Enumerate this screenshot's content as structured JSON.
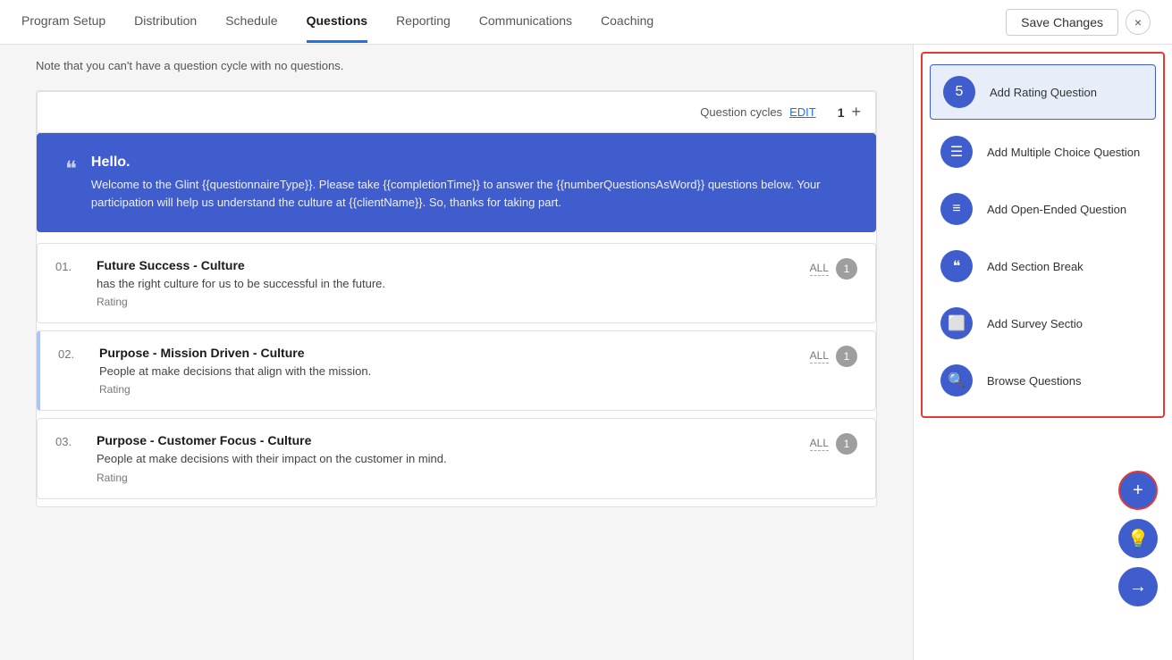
{
  "header": {
    "nav": [
      {
        "id": "program-setup",
        "label": "Program Setup",
        "active": false
      },
      {
        "id": "distribution",
        "label": "Distribution",
        "active": false
      },
      {
        "id": "schedule",
        "label": "Schedule",
        "active": false
      },
      {
        "id": "questions",
        "label": "Questions",
        "active": true
      },
      {
        "id": "reporting",
        "label": "Reporting",
        "active": false
      },
      {
        "id": "communications",
        "label": "Communications",
        "active": false
      },
      {
        "id": "coaching",
        "label": "Coaching",
        "active": false
      }
    ],
    "save_label": "Save Changes",
    "close_label": "×"
  },
  "note": "Note that you can't have a question cycle with no questions.",
  "question_cycles": {
    "label": "Question cycles",
    "edit_label": "EDIT",
    "cycle_number": "1"
  },
  "welcome": {
    "title": "Hello.",
    "body": "Welcome to the Glint {{questionnaireType}}. Please take {{completionTime}} to answer the {{numberQuestionsAsWord}} questions below. Your participation will help us understand the culture at {{clientName}}. So, thanks for taking part."
  },
  "questions": [
    {
      "number": "01.",
      "title": "Future Success - Culture",
      "body": "<COMPANY_NAME> has the right culture for us to be successful in the future.",
      "type": "Rating",
      "audience": "ALL",
      "cycle": "1"
    },
    {
      "number": "02.",
      "title": "Purpose - Mission Driven - Culture",
      "body": "People at <COMPANY_NAME> make decisions that align with the mission.",
      "type": "Rating",
      "audience": "ALL",
      "cycle": "1",
      "highlighted": true
    },
    {
      "number": "03.",
      "title": "Purpose - Customer Focus - Culture",
      "body": "People at <COMPANY_NAME> make decisions with their impact on the customer in mind.",
      "type": "Rating",
      "audience": "ALL",
      "cycle": "1"
    }
  ],
  "panel": {
    "items": [
      {
        "id": "add-rating",
        "icon": "5",
        "label": "Add Rating Question",
        "selected": true
      },
      {
        "id": "add-multiple",
        "icon": "☰",
        "label": "Add Multiple Choice Question",
        "selected": false
      },
      {
        "id": "add-open",
        "icon": "≡",
        "label": "Add Open-Ended Question",
        "selected": false
      },
      {
        "id": "add-section",
        "icon": "❝",
        "label": "Add Section Break",
        "selected": false
      },
      {
        "id": "add-survey",
        "icon": "[]",
        "label": "Add Survey Sectio",
        "selected": false
      },
      {
        "id": "browse",
        "icon": "🔍",
        "label": "Browse Questions",
        "selected": false
      }
    ]
  },
  "fab": {
    "plus_label": "+",
    "light_label": "💡",
    "arrow_label": "→"
  }
}
